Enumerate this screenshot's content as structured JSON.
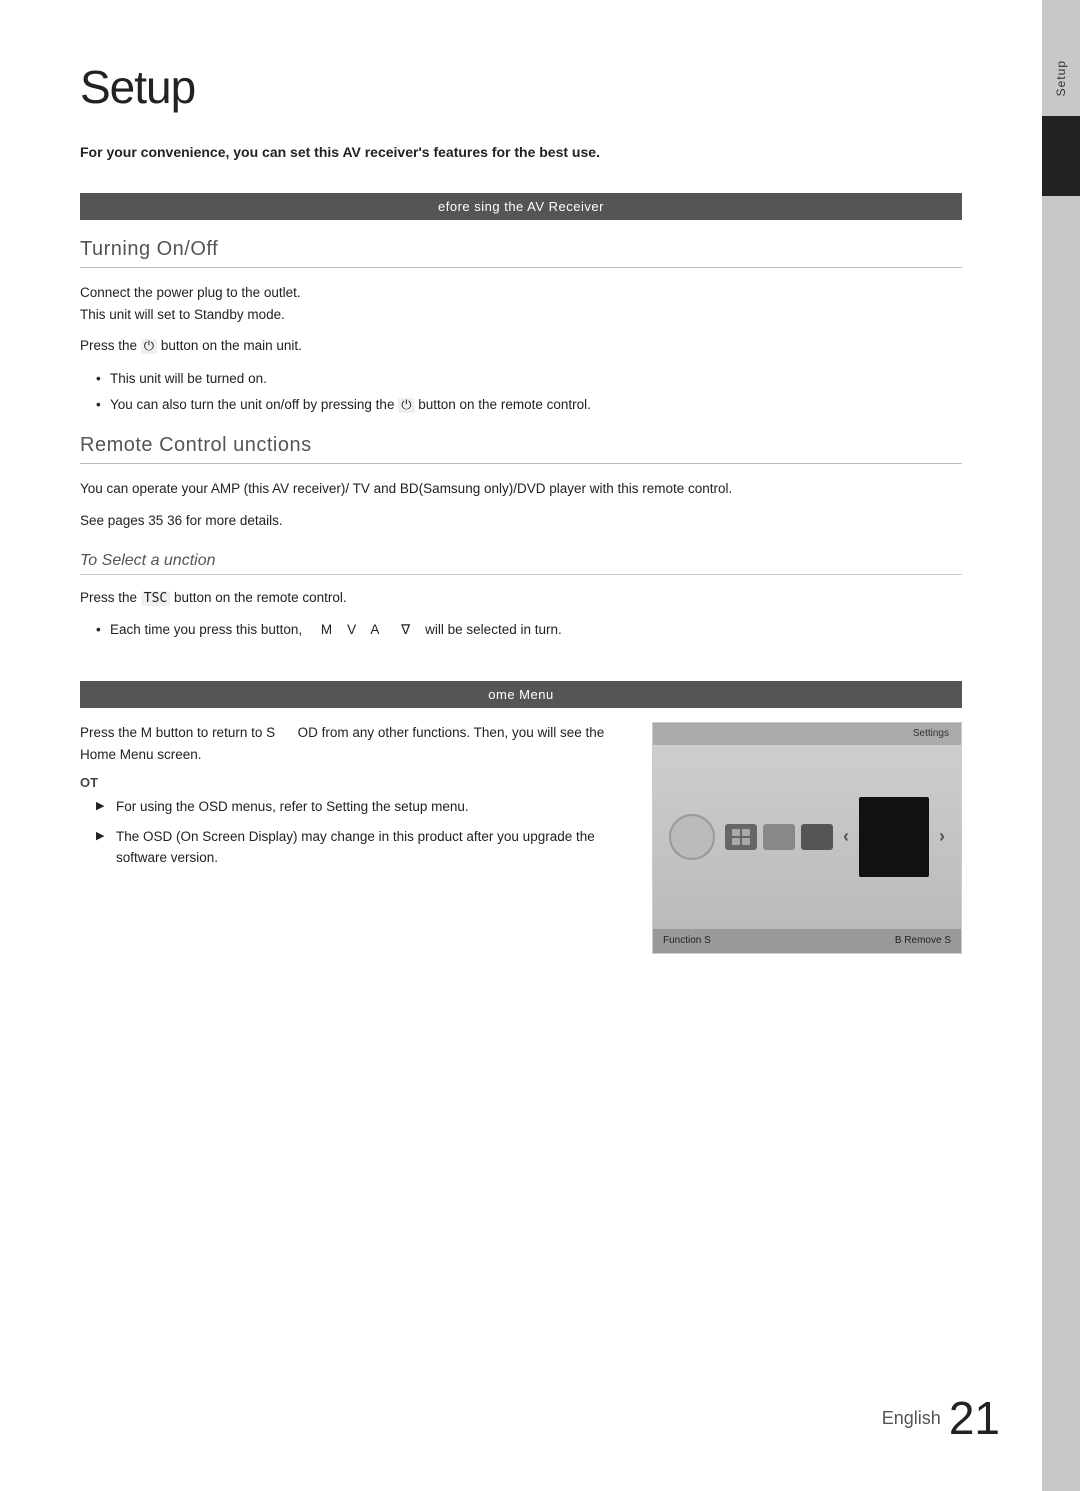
{
  "page": {
    "title": "Setup",
    "sidebar_label": "Setup",
    "footer": {
      "language": "English",
      "page_number": "21"
    }
  },
  "intro": {
    "text": "For your convenience, you can set this AV receiver's features for the best use."
  },
  "section1": {
    "header_bar": "efore sing the AV Receiver",
    "heading": "Turning On/Off",
    "para1_line1": "Connect the power plug to the outlet.",
    "para1_line2": "This unit will set to Standby mode.",
    "para2": "Press the  button on the main unit.",
    "bullet1": "This unit will be turned on.",
    "bullet2": "You can also turn the unit on/off by pressing the  button on the remote control."
  },
  "section2": {
    "heading": "Remote Control unctions",
    "para": "You can operate your AMP (this AV receiver)/ TV and BD(Samsung only)/DVD player with this remote control.",
    "para2": "See pages 35   36 for more details."
  },
  "section3": {
    "heading": "To Select a unction",
    "para": "Press the  button on the remote control.",
    "bullet": "Each time you press this button,    M   V   A      will be selected in turn."
  },
  "section4": {
    "header_bar": "ome Menu",
    "para": "Press the M button to return to S      OD from any other functions. Then, you will see the Home Menu screen.",
    "note_label": "OT",
    "arrow1": "For using the OSD menus, refer to Setting the setup menu.",
    "arrow2": "The OSD (On Screen Display) may change in this product after you upgrade the software version.",
    "osd_image": {
      "top_label": "Settings",
      "bottom_left": "Function  S",
      "bottom_right": "B  Remove S"
    }
  }
}
